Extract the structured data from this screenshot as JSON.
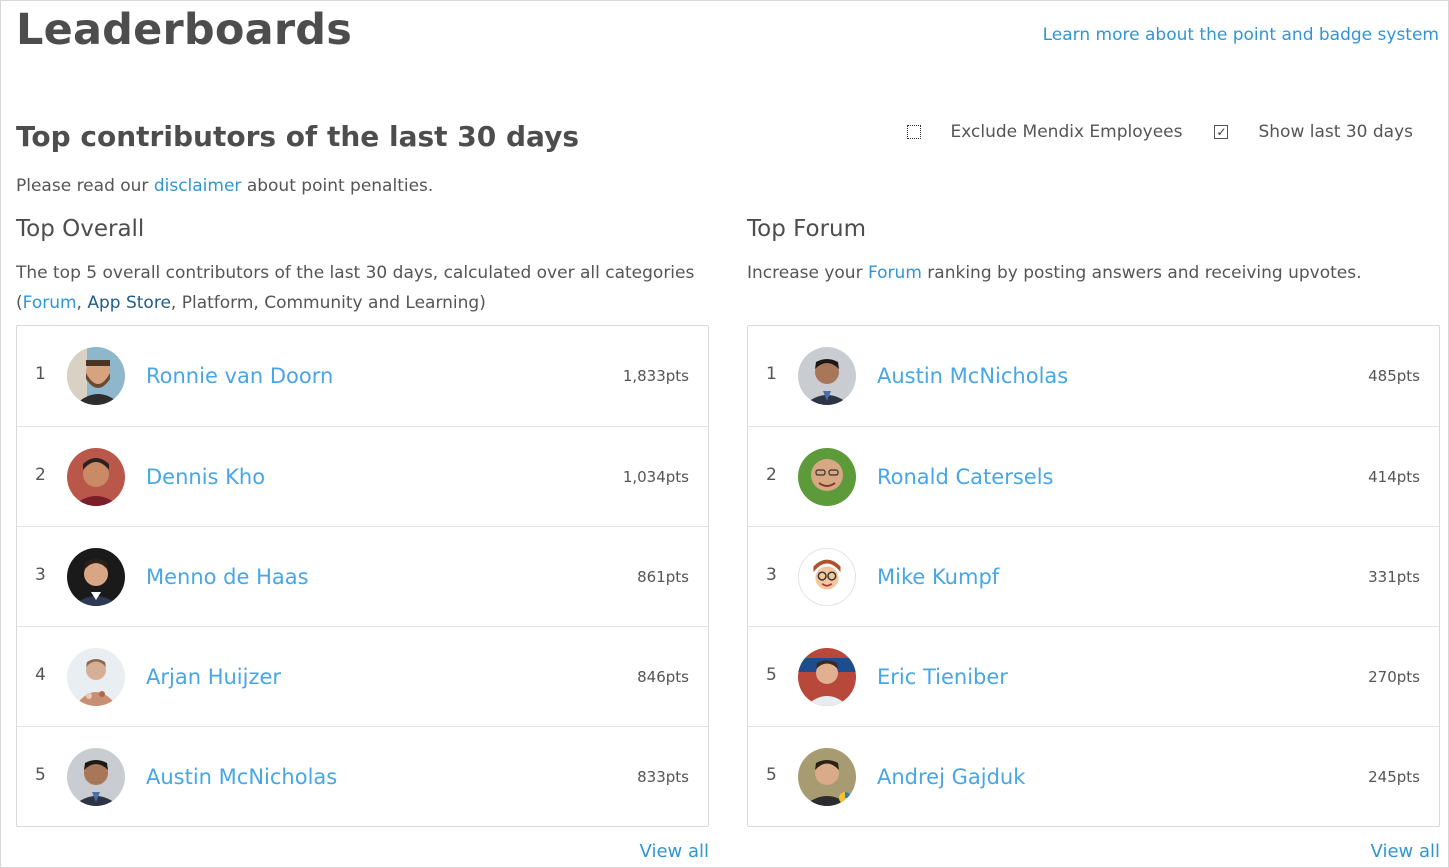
{
  "header": {
    "title": "Leaderboards",
    "learn_more": "Learn more about the point and badge system"
  },
  "section": {
    "title": "Top contributors of the last 30 days",
    "filters": [
      {
        "label": "Exclude Mendix Employees",
        "checked": false
      },
      {
        "label": "Show last 30 days",
        "checked": true
      }
    ],
    "disclaimer": {
      "before": "Please read our ",
      "link": "disclaimer",
      "after": " about point penalties."
    }
  },
  "top_overall": {
    "title": "Top Overall",
    "desc_line1": "The top 5 overall contributors of the last 30 days, calculated over all categories",
    "desc_open": "(",
    "desc_link_forum": "Forum",
    "desc_comma": ", ",
    "desc_link_appstore": "App Store",
    "desc_rest": ", Platform, Community and Learning)",
    "view_all": "View all",
    "entries": [
      {
        "rank": "1",
        "name": "Ronnie van Doorn",
        "points": "1,833pts"
      },
      {
        "rank": "2",
        "name": "Dennis Kho",
        "points": "1,034pts"
      },
      {
        "rank": "3",
        "name": "Menno de Haas",
        "points": "861pts"
      },
      {
        "rank": "4",
        "name": "Arjan Huijzer",
        "points": "846pts"
      },
      {
        "rank": "5",
        "name": "Austin McNicholas",
        "points": "833pts"
      }
    ]
  },
  "top_forum": {
    "title": "Top Forum",
    "desc_before": "Increase your ",
    "desc_link": "Forum",
    "desc_after": " ranking by posting answers and receiving upvotes.",
    "view_all": "View all",
    "entries": [
      {
        "rank": "1",
        "name": "Austin McNicholas",
        "points": "485pts"
      },
      {
        "rank": "2",
        "name": "Ronald Catersels",
        "points": "414pts"
      },
      {
        "rank": "3",
        "name": "Mike Kumpf",
        "points": "331pts"
      },
      {
        "rank": "5",
        "name": "Eric Tieniber",
        "points": "270pts"
      },
      {
        "rank": "5",
        "name": "Andrej Gajduk",
        "points": "245pts"
      }
    ]
  },
  "colors": {
    "link": "#2f96d6",
    "name_link": "#48a6e6",
    "heading": "#4d4d4d",
    "text": "#555555"
  }
}
